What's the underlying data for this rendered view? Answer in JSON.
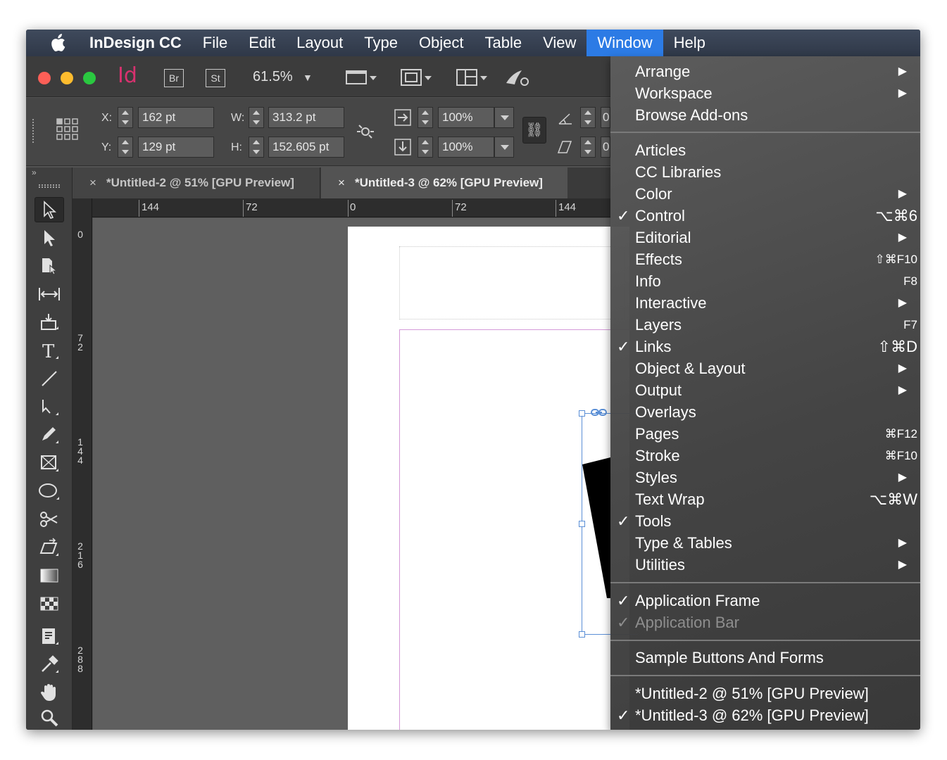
{
  "menubar": {
    "app_name": "InDesign CC",
    "items": [
      "File",
      "Edit",
      "Layout",
      "Type",
      "Object",
      "Table",
      "View",
      "Window",
      "Help"
    ],
    "active": "Window"
  },
  "app_bar": {
    "logo_text": "Id",
    "bridge_label": "Br",
    "stock_label": "St",
    "zoom": "61.5%"
  },
  "control": {
    "x_label": "X:",
    "x_value": "162 pt",
    "y_label": "Y:",
    "y_value": "129 pt",
    "w_label": "W:",
    "w_value": "313.2 pt",
    "h_label": "H:",
    "h_value": "152.605 pt",
    "scale_x": "100%",
    "scale_y": "100%",
    "field_partial_1": "0",
    "field_partial_2": "0"
  },
  "tabs": [
    {
      "close": "×",
      "label": "*Untitled-2 @ 51% [GPU Preview]",
      "active": false
    },
    {
      "close": "×",
      "label": "*Untitled-3 @ 62% [GPU Preview]",
      "active": true
    }
  ],
  "tools_header": "»",
  "ruler": {
    "top_labels": [
      "144",
      "72",
      "0",
      "72",
      "144"
    ],
    "left_labels": [
      "0",
      "72",
      "144",
      "216",
      "288"
    ]
  },
  "window_menu": {
    "section_1": [
      {
        "label": "Arrange",
        "submenu": true
      },
      {
        "label": "Workspace",
        "submenu": true
      },
      {
        "label": "Browse Add-ons"
      }
    ],
    "section_2": [
      {
        "label": "Articles"
      },
      {
        "label": "CC Libraries"
      },
      {
        "label": "Color",
        "submenu": true
      },
      {
        "label": "Control",
        "checked": true,
        "shortcut": "⌥⌘6"
      },
      {
        "label": "Editorial",
        "submenu": true
      },
      {
        "label": "Effects",
        "shortcut": "⇧⌘F10",
        "small": true
      },
      {
        "label": "Info",
        "shortcut": "F8",
        "small": true
      },
      {
        "label": "Interactive",
        "submenu": true
      },
      {
        "label": "Layers",
        "shortcut": "F7",
        "small": true
      },
      {
        "label": "Links",
        "checked": true,
        "shortcut": "⇧⌘D"
      },
      {
        "label": "Object & Layout",
        "submenu": true
      },
      {
        "label": "Output",
        "submenu": true
      },
      {
        "label": "Overlays"
      },
      {
        "label": "Pages",
        "shortcut": "⌘F12",
        "small": true
      },
      {
        "label": "Stroke",
        "shortcut": "⌘F10",
        "small": true
      },
      {
        "label": "Styles",
        "submenu": true
      },
      {
        "label": "Text Wrap",
        "shortcut": "⌥⌘W"
      },
      {
        "label": "Tools",
        "checked": true
      },
      {
        "label": "Type & Tables",
        "submenu": true
      },
      {
        "label": "Utilities",
        "submenu": true
      }
    ],
    "section_3": [
      {
        "label": "Application Frame",
        "checked": true
      },
      {
        "label": "Application Bar",
        "checked": true,
        "disabled": true
      }
    ],
    "section_4": [
      {
        "label": "Sample Buttons And Forms"
      }
    ],
    "section_5": [
      {
        "label": "*Untitled-2 @ 51% [GPU Preview]"
      },
      {
        "label": "*Untitled-3 @ 62% [GPU Preview]",
        "checked": true
      }
    ],
    "check_glyph": "✓",
    "arrow_glyph": "▶"
  },
  "colors": {
    "menubar_active": "#2c7be5",
    "id_logo": "#d7316e",
    "margin_guide": "#d59ad9",
    "selection": "#5b8fd6"
  }
}
